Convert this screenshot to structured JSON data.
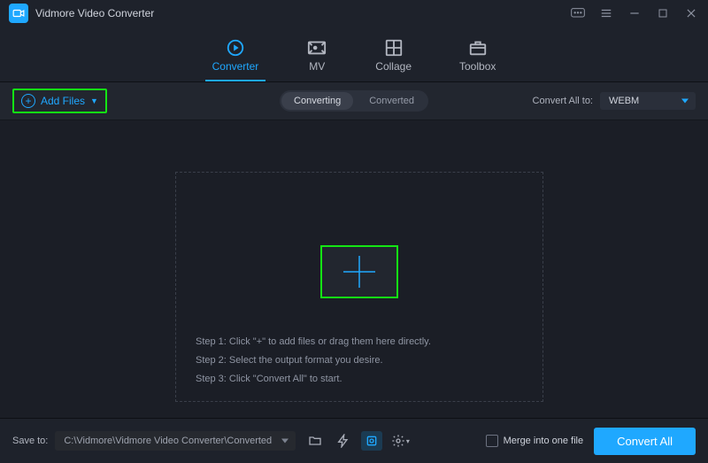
{
  "title": "Vidmore Video Converter",
  "tabs": [
    "Converter",
    "MV",
    "Collage",
    "Toolbox"
  ],
  "addFilesLabel": "Add Files",
  "subtabs": [
    "Converting",
    "Converted"
  ],
  "convertToLabel": "Convert All to:",
  "convertToFormat": "WEBM",
  "steps": {
    "s1": "Step 1: Click \"+\" to add files or drag them here directly.",
    "s2": "Step 2: Select the output format you desire.",
    "s3": "Step 3: Click \"Convert All\" to start."
  },
  "saveToLabel": "Save to:",
  "savePath": "C:\\Vidmore\\Vidmore Video Converter\\Converted",
  "mergeLabel": "Merge into one file",
  "convertAllLabel": "Convert All"
}
